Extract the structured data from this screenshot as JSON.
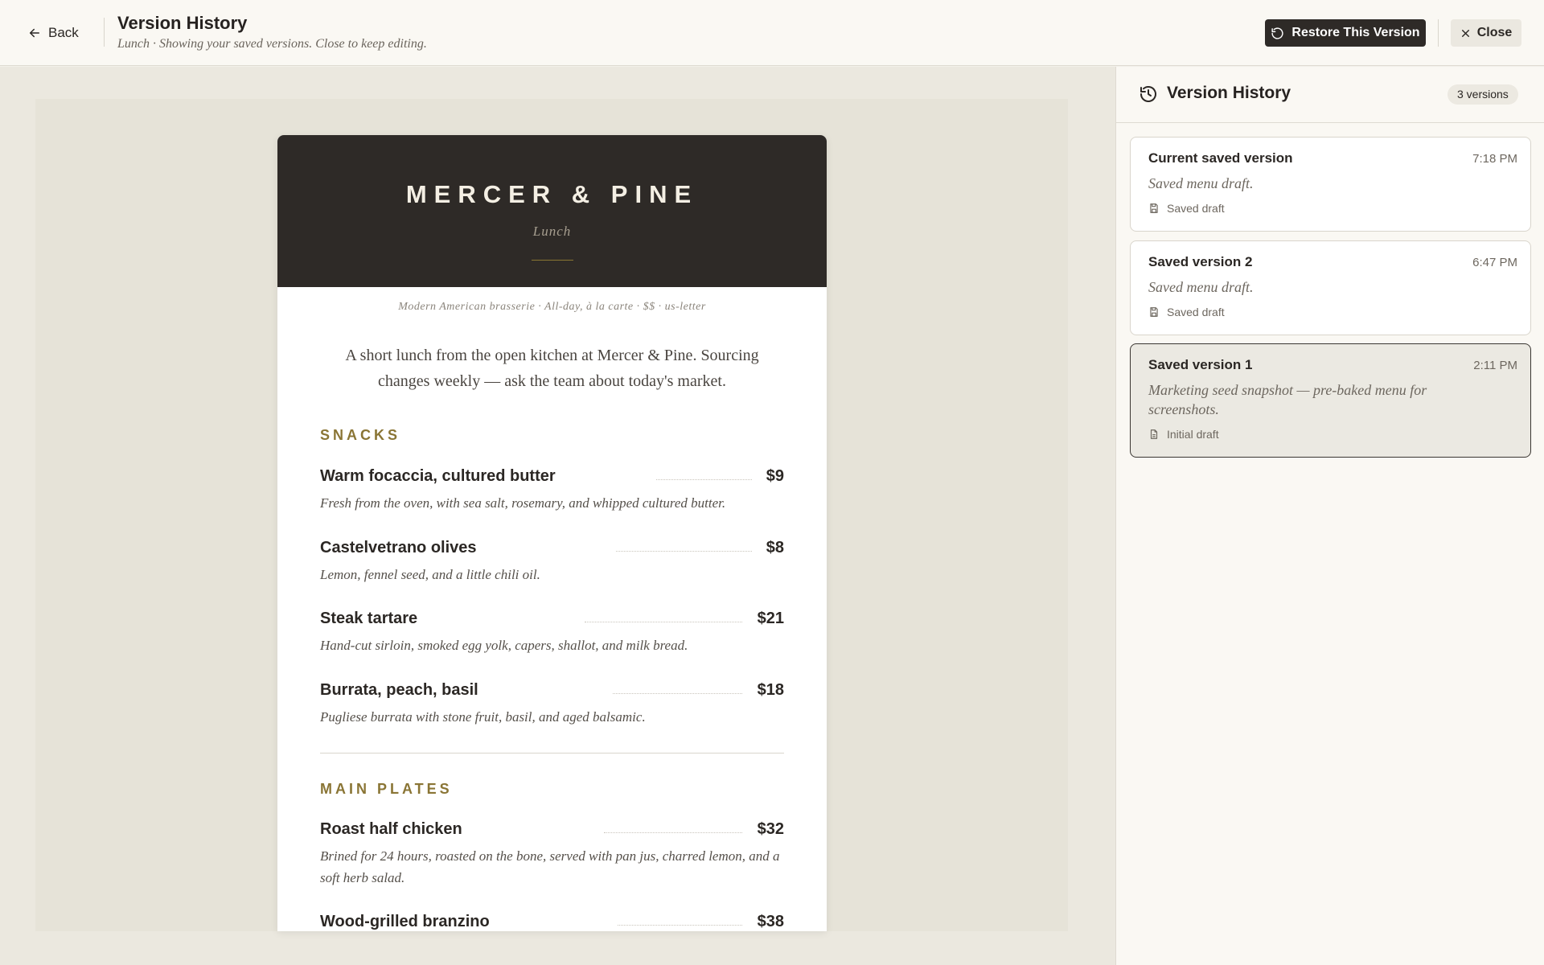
{
  "header": {
    "back_label": "Back",
    "title": "Version History",
    "subtitle": "Lunch · Showing your saved versions. Close to keep editing.",
    "restore_label": "Restore This Version",
    "close_label": "Close"
  },
  "menu": {
    "brand": "MERCER & PINE",
    "meal": "Lunch",
    "tagline": "Modern American brasserie · All-day, à la carte · $$ · us-letter",
    "intro": "A short lunch from the open kitchen at Mercer & Pine. Sourcing changes weekly — ask the team about today's market.",
    "sections": [
      {
        "title": "SNACKS",
        "items": [
          {
            "name": "Warm focaccia, cultured butter",
            "price": "$9",
            "desc": "Fresh from the oven, with sea salt, rosemary, and whipped cultured butter."
          },
          {
            "name": "Castelvetrano olives",
            "price": "$8",
            "desc": "Lemon, fennel seed, and a little chili oil."
          },
          {
            "name": "Steak tartare",
            "price": "$21",
            "desc": "Hand-cut sirloin, smoked egg yolk, capers, shallot, and milk bread."
          },
          {
            "name": "Burrata, peach, basil",
            "price": "$18",
            "desc": "Pugliese burrata with stone fruit, basil, and aged balsamic."
          }
        ]
      },
      {
        "title": "MAIN PLATES",
        "items": [
          {
            "name": "Roast half chicken",
            "price": "$32",
            "desc": "Brined for 24 hours, roasted on the bone, served with pan jus, charred lemon, and a soft herb salad."
          },
          {
            "name": "Wood-grilled branzino",
            "price": "$38",
            "desc": ""
          }
        ]
      }
    ]
  },
  "panel": {
    "title": "Version History",
    "count": "3 versions",
    "versions": [
      {
        "title": "Current saved version",
        "time": "7:18 PM",
        "desc": "Saved menu draft.",
        "meta": "Saved draft",
        "meta_icon": "save-icon",
        "selected": false
      },
      {
        "title": "Saved version 2",
        "time": "6:47 PM",
        "desc": "Saved menu draft.",
        "meta": "Saved draft",
        "meta_icon": "save-icon",
        "selected": false
      },
      {
        "title": "Saved version 1",
        "time": "2:11 PM",
        "desc": "Marketing seed snapshot — pre-baked menu for screenshots.",
        "meta": "Initial draft",
        "meta_icon": "document-icon",
        "selected": true
      }
    ]
  },
  "colors": {
    "accent_dark": "#2e2a27",
    "section_gold": "#8a7535",
    "page_bg": "#f2f0e9"
  }
}
